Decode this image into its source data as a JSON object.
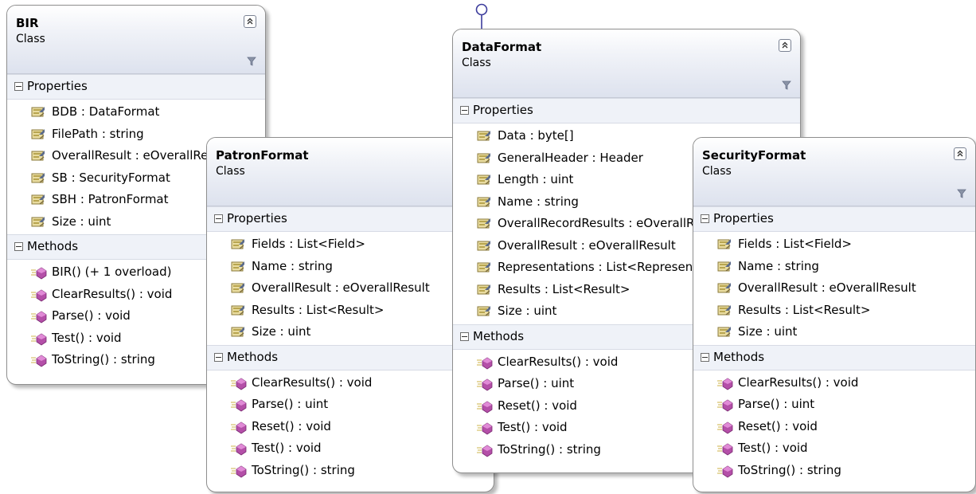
{
  "classes": {
    "bir": {
      "name": "BIR",
      "stereotype": "Class",
      "properties_label": "Properties",
      "methods_label": "Methods",
      "properties": [
        "BDB : DataFormat",
        "FilePath : string",
        "OverallResult : eOverallResult",
        "SB : SecurityFormat",
        "SBH : PatronFormat",
        "Size : uint"
      ],
      "methods": [
        "BIR() (+ 1 overload)",
        "ClearResults() : void",
        "Parse() : void",
        "Test() : void",
        "ToString() : string"
      ]
    },
    "patron": {
      "name": "PatronFormat",
      "stereotype": "Class",
      "properties_label": "Properties",
      "methods_label": "Methods",
      "properties": [
        "Fields : List<Field>",
        "Name : string",
        "OverallResult : eOverallResult",
        "Results : List<Result>",
        "Size : uint"
      ],
      "methods": [
        "ClearResults() : void",
        "Parse() : uint",
        "Reset() : void",
        "Test() : void",
        "ToString() : string"
      ]
    },
    "data": {
      "name": "DataFormat",
      "stereotype": "Class",
      "properties_label": "Properties",
      "methods_label": "Methods",
      "properties": [
        "Data : byte[]",
        "GeneralHeader : Header",
        "Length : uint",
        "Name : string",
        "OverallRecordResults : eOverallResult",
        "OverallResult : eOverallResult",
        "Representations : List<Representation>",
        "Results : List<Result>",
        "Size : uint"
      ],
      "methods": [
        "ClearResults() : void",
        "Parse() : uint",
        "Reset() : void",
        "Test() : void",
        "ToString() : string"
      ]
    },
    "security": {
      "name": "SecurityFormat",
      "stereotype": "Class",
      "properties_label": "Properties",
      "methods_label": "Methods",
      "properties": [
        "Fields : List<Field>",
        "Name : string",
        "OverallResult : eOverallResult",
        "Results : List<Result>",
        "Size : uint"
      ],
      "methods": [
        "ClearResults() : void",
        "Parse() : uint",
        "Reset() : void",
        "Test() : void",
        "ToString() : string"
      ]
    }
  },
  "icons": {
    "property": "property-icon",
    "method": "method-icon",
    "collapse": "collapse-chevrons-icon",
    "filter": "filter-icon",
    "interface": "interface-lollipop-icon"
  },
  "colors": {
    "header_gradient_end": "#dde2ee",
    "section_bg": "#eff2f8",
    "border": "#8e8e8e",
    "lollipop": "#3c3c9c",
    "method_icon": "#b44fa8"
  }
}
